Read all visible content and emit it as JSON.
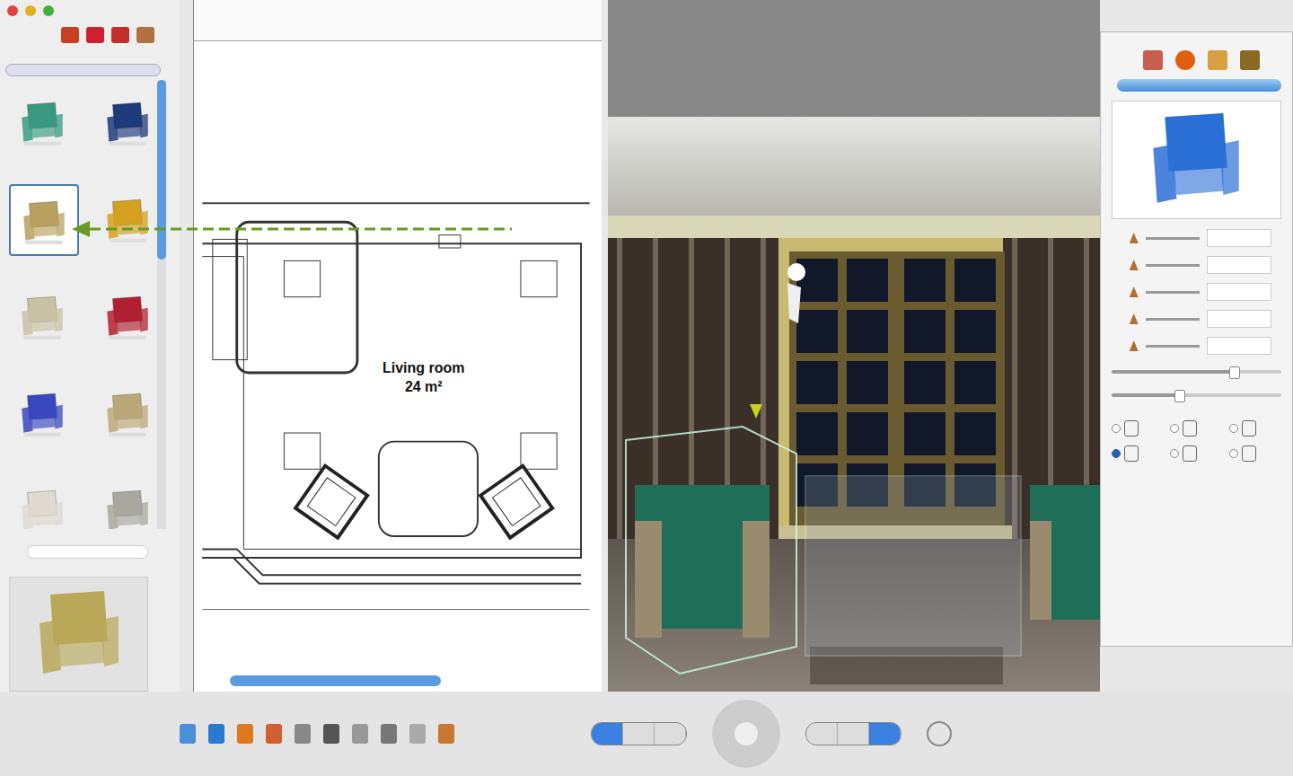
{
  "catalog": {
    "items": [
      {
        "color": "#3a9a80",
        "selected": false
      },
      {
        "color": "#1d3a7a",
        "selected": false
      },
      {
        "color": "#b8a060",
        "selected": true
      },
      {
        "color": "#d4a020",
        "selected": false
      },
      {
        "color": "#c8c2a4",
        "selected": false
      },
      {
        "color": "#b02030",
        "selected": false
      },
      {
        "color": "#3a48c0",
        "selected": false
      },
      {
        "color": "#bba878",
        "selected": false
      },
      {
        "color": "#dedad0",
        "selected": false
      },
      {
        "color": "#a8a89e",
        "selected": false
      }
    ],
    "preview_color": "#b8a858"
  },
  "plan": {
    "room_name": "Living room",
    "room_area": "24 m²"
  },
  "inspector": {
    "preview_color": "#2a6fd6",
    "sliders": [
      {
        "level": 0.72
      },
      {
        "level": 0.4
      }
    ],
    "texture_options": [
      {
        "selected": false
      },
      {
        "selected": false
      },
      {
        "selected": false
      },
      {
        "selected": true
      },
      {
        "selected": false
      },
      {
        "selected": false
      }
    ]
  },
  "plan_modes": [
    {
      "selected": true
    },
    {
      "selected": false
    },
    {
      "selected": false
    }
  ],
  "view_modes": [
    {
      "selected": false
    },
    {
      "selected": false
    },
    {
      "selected": true
    }
  ]
}
